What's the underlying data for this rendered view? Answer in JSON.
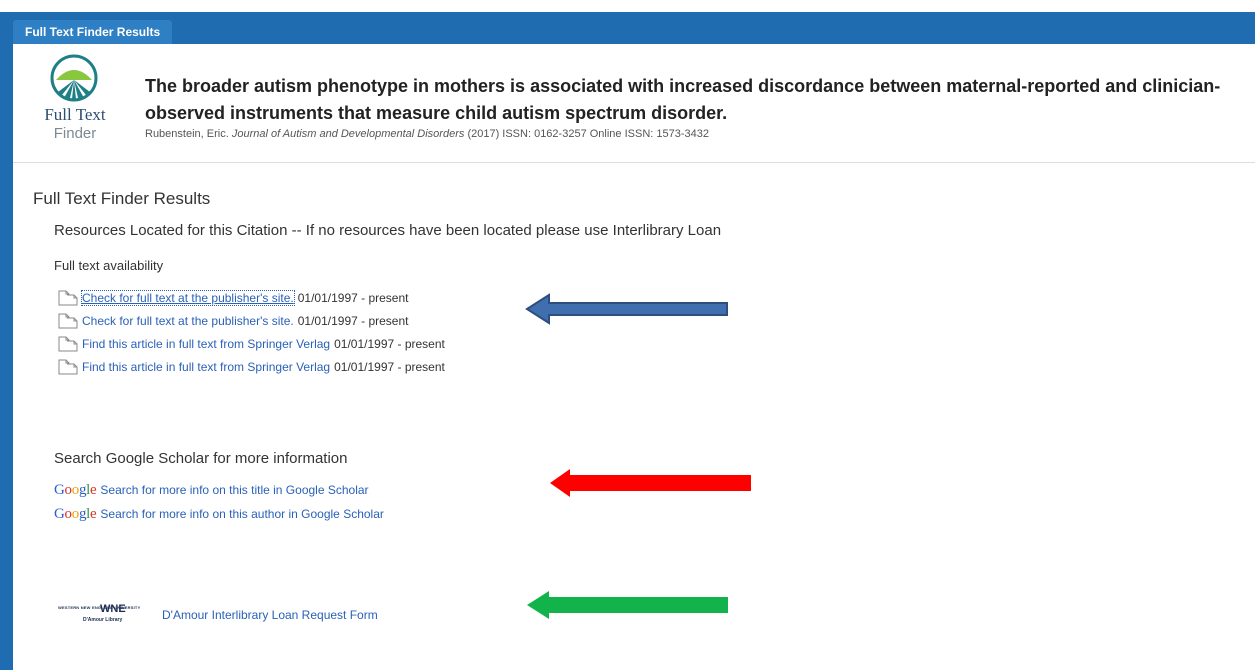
{
  "tab": {
    "label": "Full Text Finder Results"
  },
  "logo": {
    "line1": "Full Text",
    "line2": "Finder"
  },
  "article": {
    "title": "The broader autism phenotype in mothers is associated with increased discordance between maternal-reported and clinician-observed instruments that measure child autism spectrum disorder.",
    "author": "Rubenstein, Eric.",
    "journal": "Journal of Autism and Developmental Disorders",
    "details": "(2017) ISSN: 0162-3257 Online ISSN: 1573-3432"
  },
  "results": {
    "heading": "Full Text Finder Results",
    "resources_line": "Resources Located for this Citation -- If no resources have been located please use Interlibrary Loan",
    "availability_heading": "Full text availability",
    "links": [
      {
        "label": "Check for full text at the publisher's site.",
        "dates": "01/01/1997 - present"
      },
      {
        "label": "Check for full text at the publisher's site.",
        "dates": "01/01/1997 - present"
      },
      {
        "label": "Find this article in full text from Springer Verlag",
        "dates": "01/01/1997 - present"
      },
      {
        "label": "Find this article in full text from Springer Verlag",
        "dates": "01/01/1997 - present"
      }
    ]
  },
  "scholar": {
    "heading": "Search Google Scholar for more information",
    "logo_text": "Google",
    "links": [
      {
        "label": "Search for more info on this title in Google Scholar"
      },
      {
        "label": "Search for more info on this author in Google Scholar"
      }
    ]
  },
  "interlibrary": {
    "logo_small": "WESTERN NEW ENGLAND UNIVERSITY",
    "logo_big": "WNE",
    "logo_library": "D'Amour Library",
    "link_label": "D'Amour Interlibrary Loan Request Form"
  },
  "colors": {
    "header_blue": "#1f6db0",
    "link_blue": "#2a61b8",
    "arrow_blue": "#3f6fae",
    "arrow_red": "#ff0000",
    "arrow_green": "#12b34a"
  }
}
